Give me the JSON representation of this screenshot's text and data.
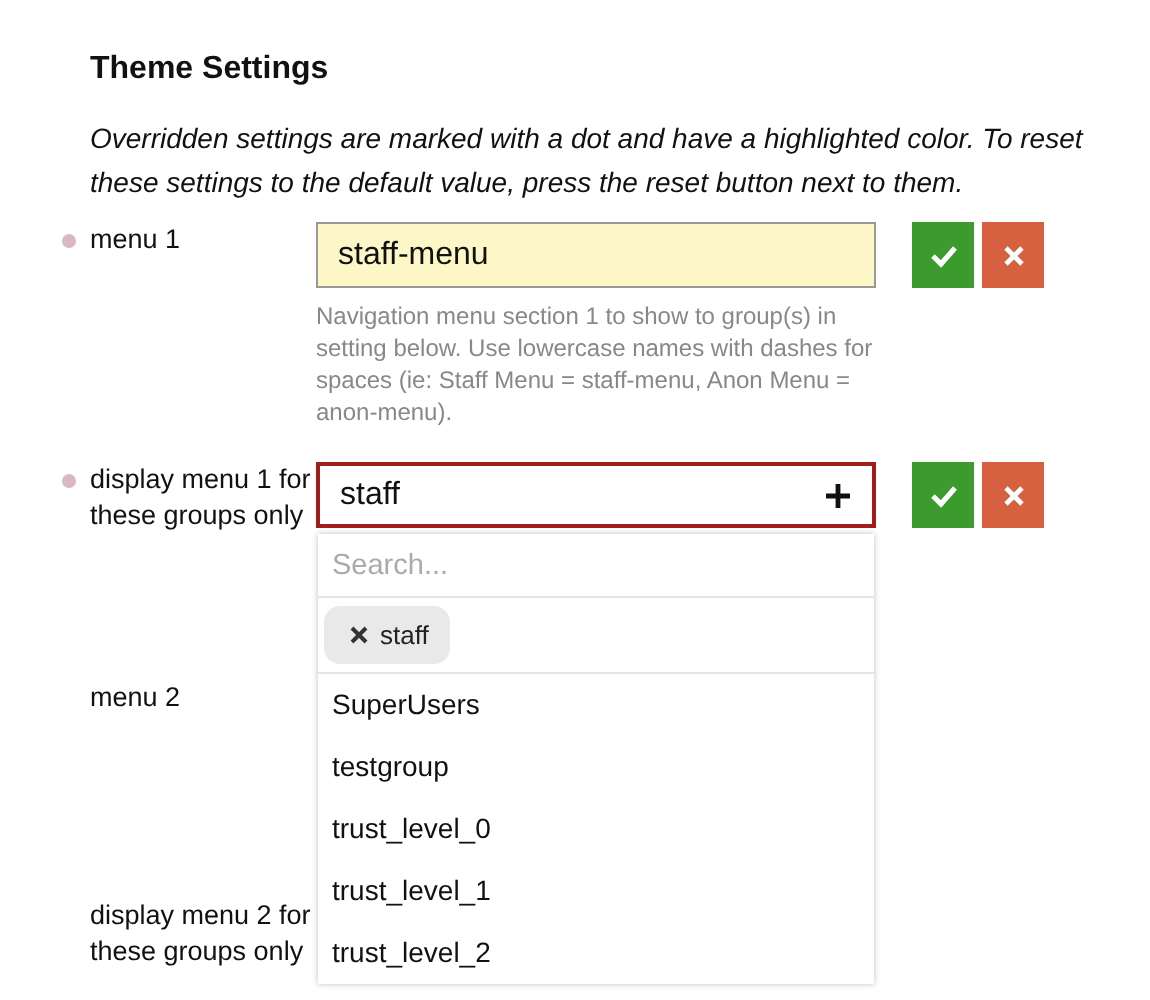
{
  "title": "Theme Settings",
  "description": "Overridden settings are marked with a dot and have a highlighted color. To reset these settings to the default value, press the reset button next to them.",
  "settings": [
    {
      "label": "menu 1",
      "overridden": true,
      "kind": "text",
      "value": "staff-menu",
      "dirty": true,
      "help": "Navigation menu section 1 to show to group(s) in setting below. Use lowercase names with dashes for spaces (ie: Staff Menu = staff-menu, Anon Menu = anon-menu)."
    },
    {
      "label": "display menu 1 for these groups only",
      "overridden": true,
      "kind": "group-list",
      "value": "staff",
      "dirty": true,
      "focused": true,
      "expanded": true,
      "dropdown": {
        "placeholder": "Search...",
        "chips": [
          "staff"
        ],
        "options": [
          "SuperUsers",
          "testgroup",
          "trust_level_0",
          "trust_level_1",
          "trust_level_2"
        ]
      }
    },
    {
      "label": "menu 2",
      "overridden": false
    },
    {
      "label": "display menu 2 for these groups only",
      "overridden": false
    }
  ]
}
